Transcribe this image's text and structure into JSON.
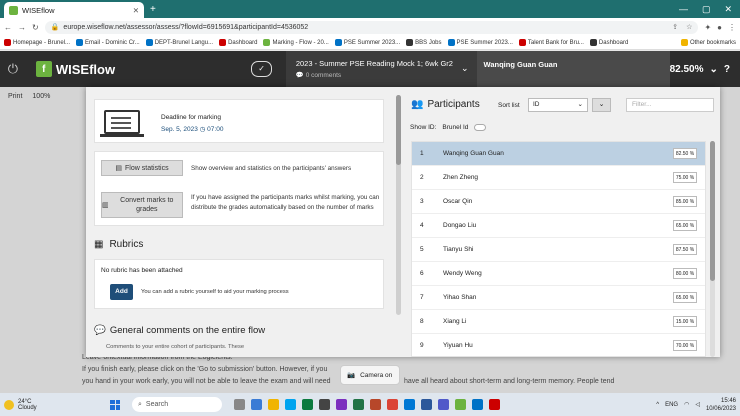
{
  "browser": {
    "tab_title": "WISEflow",
    "url": "europe.wiseflow.net/assessor/assess/?flowId=6915691&participantId=4536052",
    "bookmarks": [
      "Homepage - Brunel...",
      "Email - Dominic Cr...",
      "DEPT-Brunel Langu...",
      "Dashboard",
      "Marking - Flow - 20...",
      "PSE Summer 2023...",
      "BBS Jobs",
      "PSE Summer 2023...",
      "Talent Bank for Bru...",
      "Dashboard"
    ],
    "other_bookmarks": "Other bookmarks"
  },
  "app": {
    "brand": "WISEflow",
    "flow_title": "2023 - Summer PSE Reading Mock 1; 6wk Gr2",
    "comments": "0 comments",
    "participant_name": "Wanqing Guan Guan",
    "participant_score": "82.50%"
  },
  "bg": {
    "print": "Print",
    "zoom": "100%",
    "line1": "Leave-ontextual information from the Eoglelents.",
    "line2": "If you finish early, please click on the 'Go to submission' button. However, if you",
    "line3": "you hand in your work early, you will not be able to leave the exam and will need",
    "line4": "have all heard about short-term and long-term memory. People tend"
  },
  "deadline": {
    "label": "Deadline for marking",
    "date": "Sep. 5, 2023",
    "time": "07:00"
  },
  "actions": {
    "stats_btn": "Flow statistics",
    "stats_desc": "Show overview and statistics on the participants' answers",
    "convert_btn": "Convert marks to grades",
    "convert_desc": "If you have assigned the participants marks whilst marking, you can distribute the grades automatically based on the number of marks"
  },
  "rubrics": {
    "title": "Rubrics",
    "none": "No rubric has been attached",
    "add": "Add",
    "add_desc": "You can add a rubric yourself to aid your marking process"
  },
  "general": {
    "title": "General comments on the entire flow",
    "sub": "Comments to your entire cohort of participants. These"
  },
  "participants": {
    "title": "Participants",
    "sort_label": "Sort list",
    "sort_value": "ID",
    "filter_placeholder": "Filter...",
    "showid_label": "Show ID:",
    "showid_value": "Brunel Id",
    "rows": [
      {
        "no": "1",
        "name": "Wanqing Guan Guan",
        "score": "82.50 %"
      },
      {
        "no": "2",
        "name": "Zhen Zheng",
        "score": "75.00 %"
      },
      {
        "no": "3",
        "name": "Oscar Qin",
        "score": "85.00 %"
      },
      {
        "no": "4",
        "name": "Dongao Liu",
        "score": "65.00 %"
      },
      {
        "no": "5",
        "name": "Tianyu Shi",
        "score": "87.50 %"
      },
      {
        "no": "6",
        "name": "Wendy Weng",
        "score": "80.00 %"
      },
      {
        "no": "7",
        "name": "Yihao Shan",
        "score": "65.00 %"
      },
      {
        "no": "8",
        "name": "Xiang Li",
        "score": "15.00 %"
      },
      {
        "no": "9",
        "name": "Yiyuan Hu",
        "score": "70.00 %"
      }
    ]
  },
  "camera": "Camera on",
  "taskbar": {
    "temp": "24°C",
    "weather": "Cloudy",
    "search": "Search",
    "lang": "ENG",
    "time": "15:46",
    "date": "10/06/2023"
  },
  "colors": {
    "brand_green": "#6cb33f",
    "selected_row": "#bcd0e2",
    "add_button": "#1f4e79"
  }
}
